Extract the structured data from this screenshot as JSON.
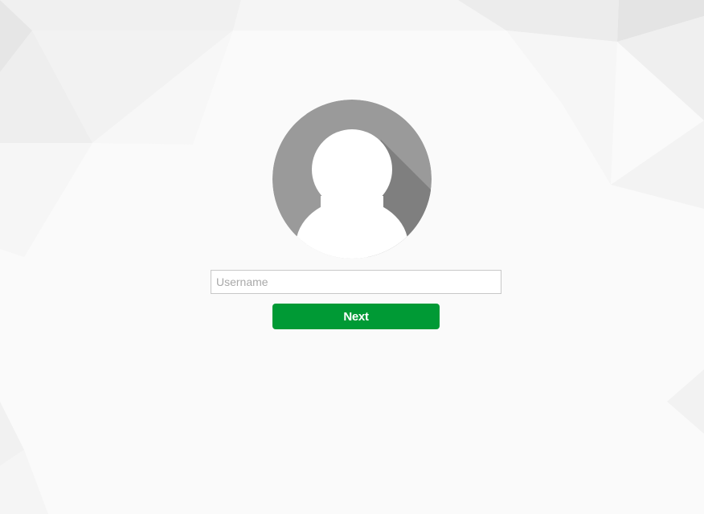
{
  "login": {
    "avatar_icon": "default-user-avatar-icon",
    "username_placeholder": "Username",
    "username_value": "",
    "next_label": "Next"
  },
  "colors": {
    "background": "#fafafa",
    "button": "#009a35",
    "button_text": "#ffffff",
    "avatar_circle": "#9a9a9a",
    "avatar_shadow": "#7d7d7d"
  }
}
